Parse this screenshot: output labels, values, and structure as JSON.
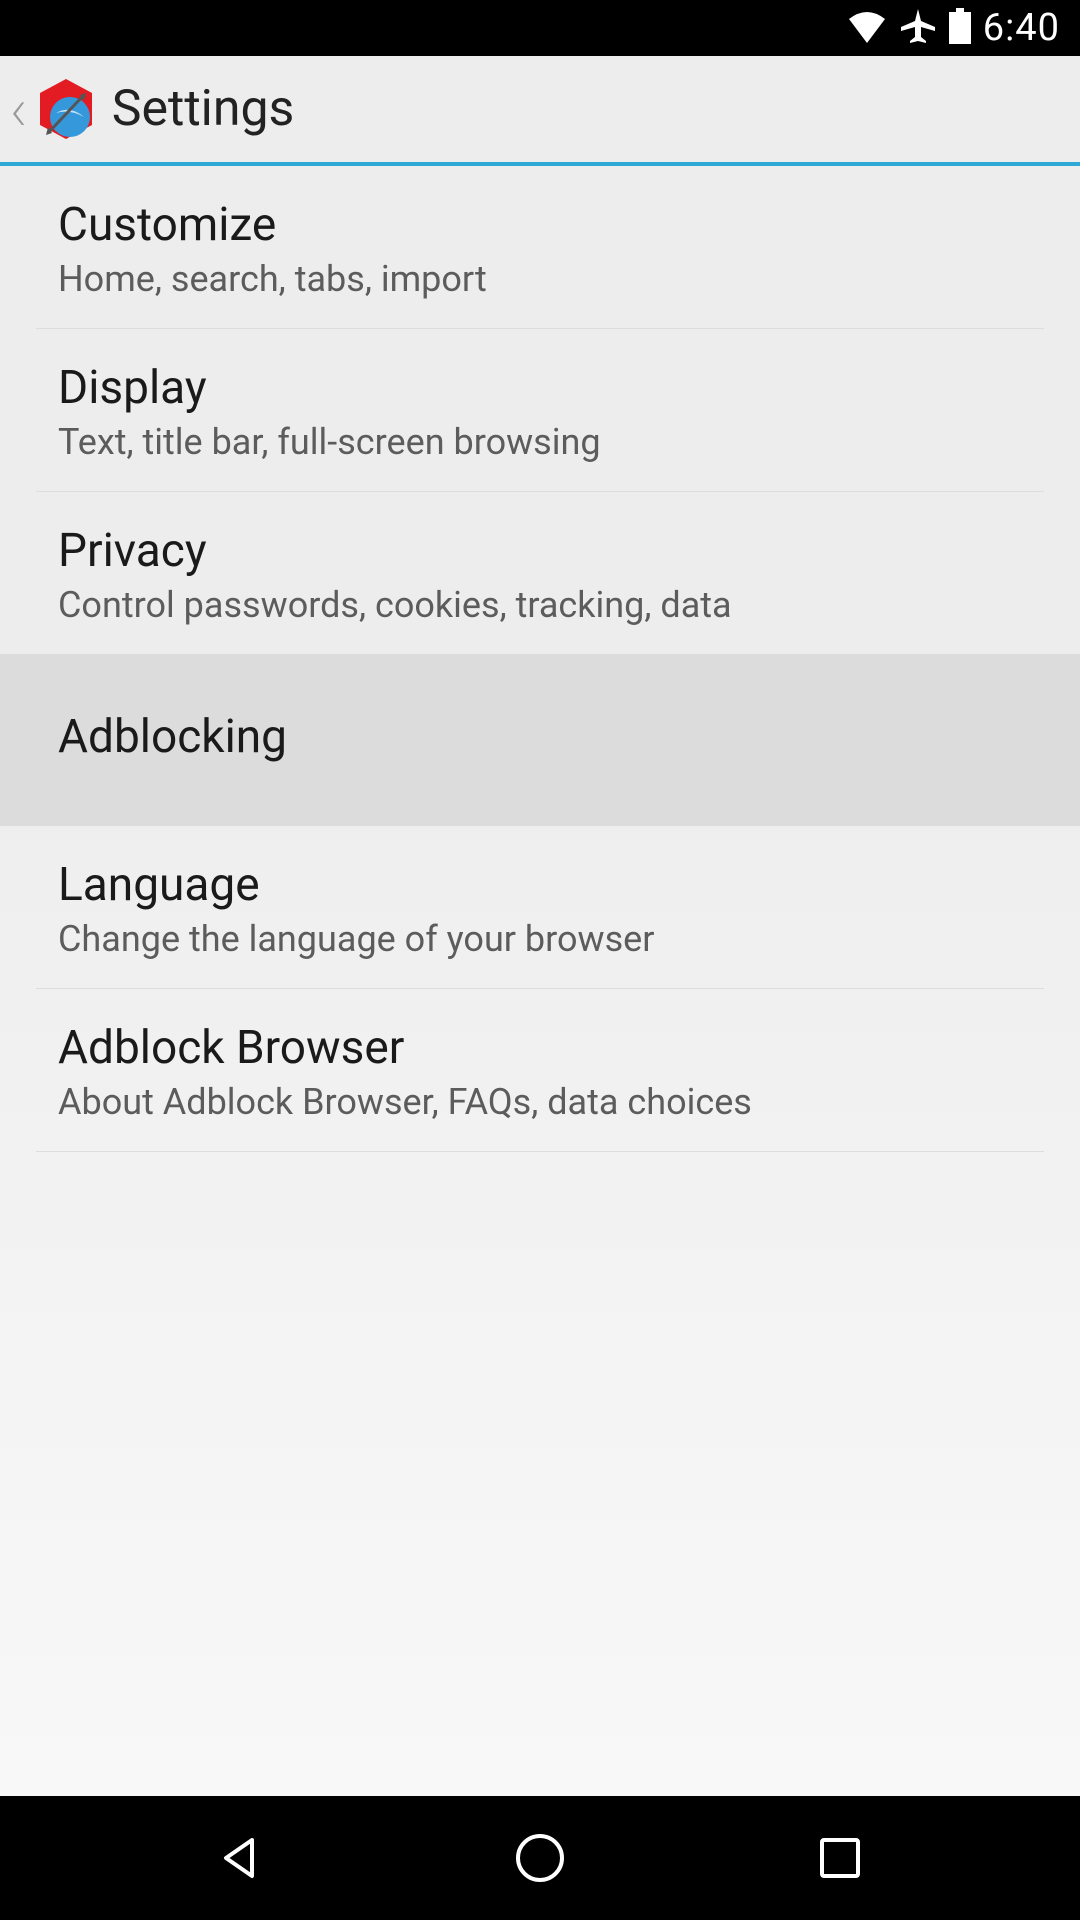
{
  "status_bar": {
    "time": "6:40"
  },
  "header": {
    "title": "Settings"
  },
  "settings": {
    "items": [
      {
        "title": "Customize",
        "subtitle": "Home, search, tabs, import",
        "highlighted": false
      },
      {
        "title": "Display",
        "subtitle": "Text, title bar, full-screen browsing",
        "highlighted": false
      },
      {
        "title": "Privacy",
        "subtitle": "Control passwords, cookies, tracking, data",
        "highlighted": false
      },
      {
        "title": "Adblocking",
        "subtitle": "",
        "highlighted": true
      },
      {
        "title": "Language",
        "subtitle": "Change the language of your browser",
        "highlighted": false
      },
      {
        "title": "Adblock Browser",
        "subtitle": "About Adblock Browser, FAQs, data choices",
        "highlighted": false
      }
    ]
  }
}
